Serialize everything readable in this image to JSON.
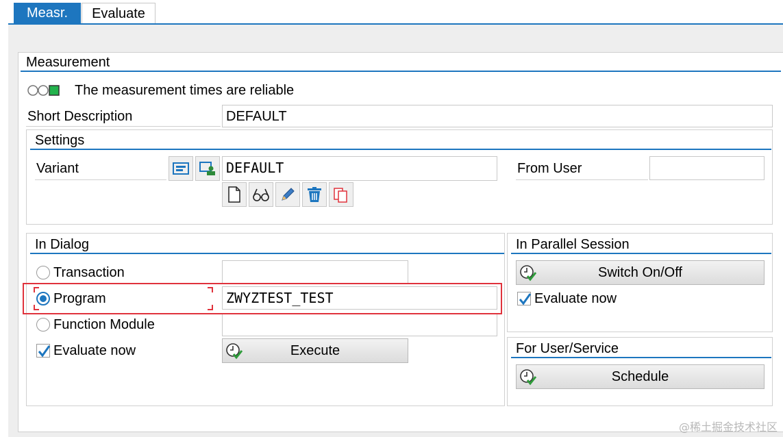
{
  "tabs": [
    {
      "label": "Measr.",
      "active": true
    },
    {
      "label": "Evaluate",
      "active": false
    }
  ],
  "measurement": {
    "title": "Measurement",
    "status_text": "The measurement times are reliable",
    "short_description_label": "Short Description",
    "short_description_value": "DEFAULT"
  },
  "settings": {
    "title": "Settings",
    "variant_label": "Variant",
    "variant_value": "DEFAULT",
    "from_user_label": "From User",
    "from_user_value": ""
  },
  "in_dialog": {
    "title": "In Dialog",
    "options": [
      {
        "label": "Transaction",
        "value": "",
        "selected": false
      },
      {
        "label": "Program",
        "value": "ZWYZTEST_TEST",
        "selected": true
      },
      {
        "label": "Function Module",
        "value": "",
        "selected": false
      }
    ],
    "evaluate_now_label": "Evaluate now",
    "evaluate_now_checked": true,
    "execute_label": "Execute"
  },
  "parallel": {
    "title": "In Parallel Session",
    "switch_label": "Switch On/Off",
    "evaluate_now_label": "Evaluate now",
    "evaluate_now_checked": true
  },
  "user_service": {
    "title": "For User/Service",
    "schedule_label": "Schedule"
  },
  "watermark": "@稀土掘金技术社区",
  "colors": {
    "accent": "#1d76bf",
    "highlight": "#e0323c",
    "status_green": "#22b24c"
  }
}
